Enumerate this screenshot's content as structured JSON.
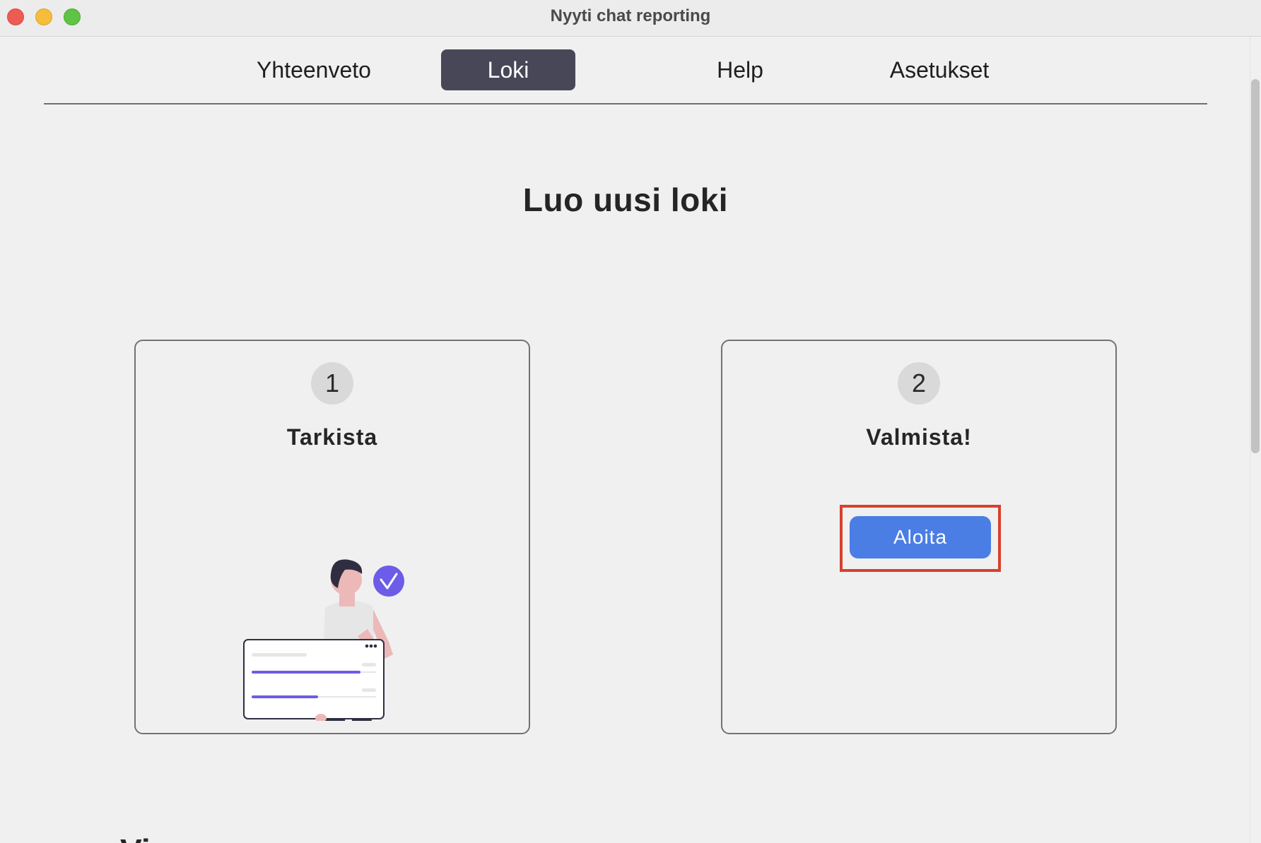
{
  "window": {
    "title": "Nyyti chat reporting"
  },
  "nav": {
    "tabs": [
      {
        "label": "Yhteenveto",
        "active": false
      },
      {
        "label": "Loki",
        "active": true
      },
      {
        "label": "Help",
        "active": false
      },
      {
        "label": "Asetukset",
        "active": false
      }
    ]
  },
  "main": {
    "title": "Luo uusi loki",
    "steps": [
      {
        "number": "1",
        "title": "Tarkista",
        "icon": "person-checklist-illustration"
      },
      {
        "number": "2",
        "title": "Valmista!",
        "button_label": "Aloita"
      }
    ],
    "next_heading_partial": "Vi"
  },
  "colors": {
    "active_tab": "#474757",
    "primary_button": "#4a7ee5",
    "highlight_border": "#d8402c",
    "illustration_accent": "#6c5ce7"
  }
}
